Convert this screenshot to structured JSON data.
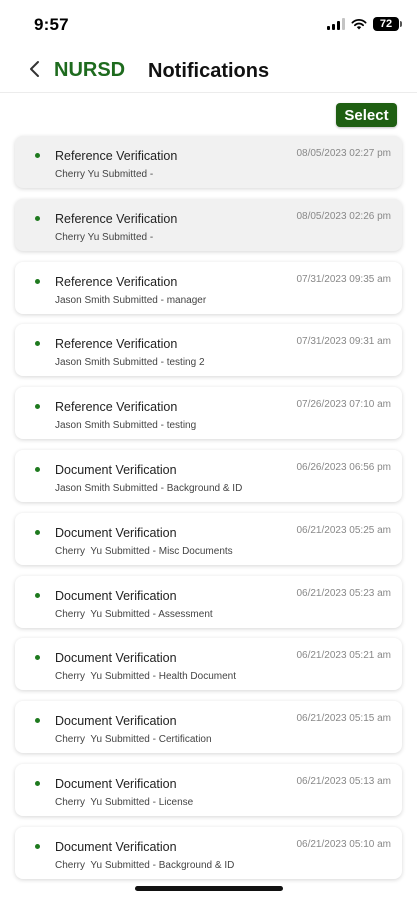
{
  "status": {
    "time": "9:57",
    "battery": "72"
  },
  "header": {
    "brand": "NURSD",
    "title": "Notifications"
  },
  "toolbar": {
    "select_label": "Select"
  },
  "colors": {
    "brand": "#1e6b1e",
    "accent": "#1f5f12",
    "unread_dot": "#1f7a1f"
  },
  "icons": {
    "back": "chevron-left-icon",
    "signal": "cellular-signal-icon",
    "wifi": "wifi-icon",
    "battery": "battery-icon"
  },
  "notifications": [
    {
      "title": "Reference Verification",
      "subtitle": "Cherry Yu Submitted -",
      "time": "08/05/2023 02:27 pm",
      "highlighted": true
    },
    {
      "title": "Reference Verification",
      "subtitle": "Cherry Yu Submitted -",
      "time": "08/05/2023 02:26 pm",
      "highlighted": true
    },
    {
      "title": "Reference Verification",
      "subtitle": "Jason Smith Submitted - manager",
      "time": "07/31/2023 09:35 am",
      "highlighted": false
    },
    {
      "title": "Reference Verification",
      "subtitle": "Jason Smith Submitted - testing 2",
      "time": "07/31/2023 09:31 am",
      "highlighted": false
    },
    {
      "title": "Reference Verification",
      "subtitle": "Jason Smith Submitted - testing",
      "time": "07/26/2023 07:10 am",
      "highlighted": false
    },
    {
      "title": "Document Verification",
      "subtitle": "Jason Smith Submitted - Background & ID",
      "time": "06/26/2023 06:56 pm",
      "highlighted": false
    },
    {
      "title": "Document Verification",
      "subtitle": "Cherry  Yu Submitted - Misc Documents",
      "time": "06/21/2023 05:25 am",
      "highlighted": false
    },
    {
      "title": "Document Verification",
      "subtitle": "Cherry  Yu Submitted - Assessment",
      "time": "06/21/2023 05:23 am",
      "highlighted": false
    },
    {
      "title": "Document Verification",
      "subtitle": "Cherry  Yu Submitted - Health Document",
      "time": "06/21/2023 05:21 am",
      "highlighted": false
    },
    {
      "title": "Document Verification",
      "subtitle": "Cherry  Yu Submitted - Certification",
      "time": "06/21/2023 05:15 am",
      "highlighted": false
    },
    {
      "title": "Document Verification",
      "subtitle": "Cherry  Yu Submitted - License",
      "time": "06/21/2023 05:13 am",
      "highlighted": false
    },
    {
      "title": "Document Verification",
      "subtitle": "Cherry  Yu Submitted - Background & ID",
      "time": "06/21/2023 05:10 am",
      "highlighted": false
    }
  ]
}
